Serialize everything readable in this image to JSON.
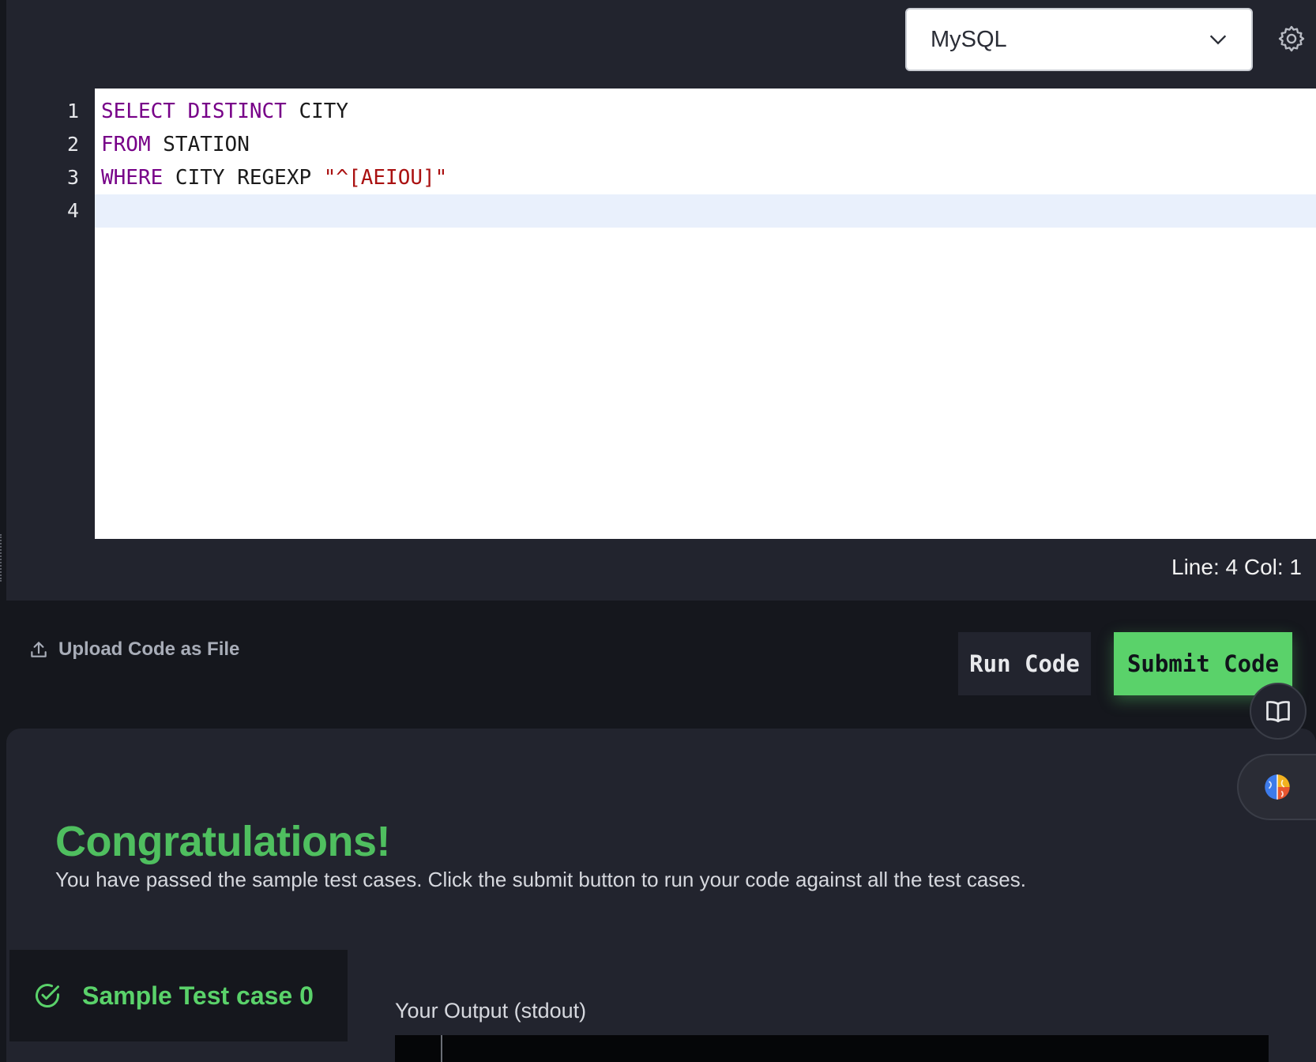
{
  "editor": {
    "language": "MySQL",
    "lines": [
      {
        "num": "1",
        "kw1": "SELECT",
        "kw2": "DISTINCT",
        "rest": " CITY"
      },
      {
        "num": "2",
        "kw1": "FROM",
        "rest": " STATION"
      },
      {
        "num": "3",
        "kw1": "WHERE",
        "rest": " CITY REGEXP ",
        "str": "\"^[AEIOU]\""
      },
      {
        "num": "4"
      }
    ],
    "status": "Line: 4 Col: 1"
  },
  "actions": {
    "upload_label": "Upload Code as File",
    "run_label": "Run Code",
    "submit_label": "Submit Code"
  },
  "results": {
    "title": "Congratulations!",
    "message": "You have passed the sample test cases. Click the submit button to run your code against all the test cases.",
    "test_case_label": "Sample Test case 0",
    "output_label": "Your Output (stdout)"
  },
  "colors": {
    "accent_green": "#5ad26a",
    "keyword": "#770088",
    "string": "#aa1111"
  }
}
